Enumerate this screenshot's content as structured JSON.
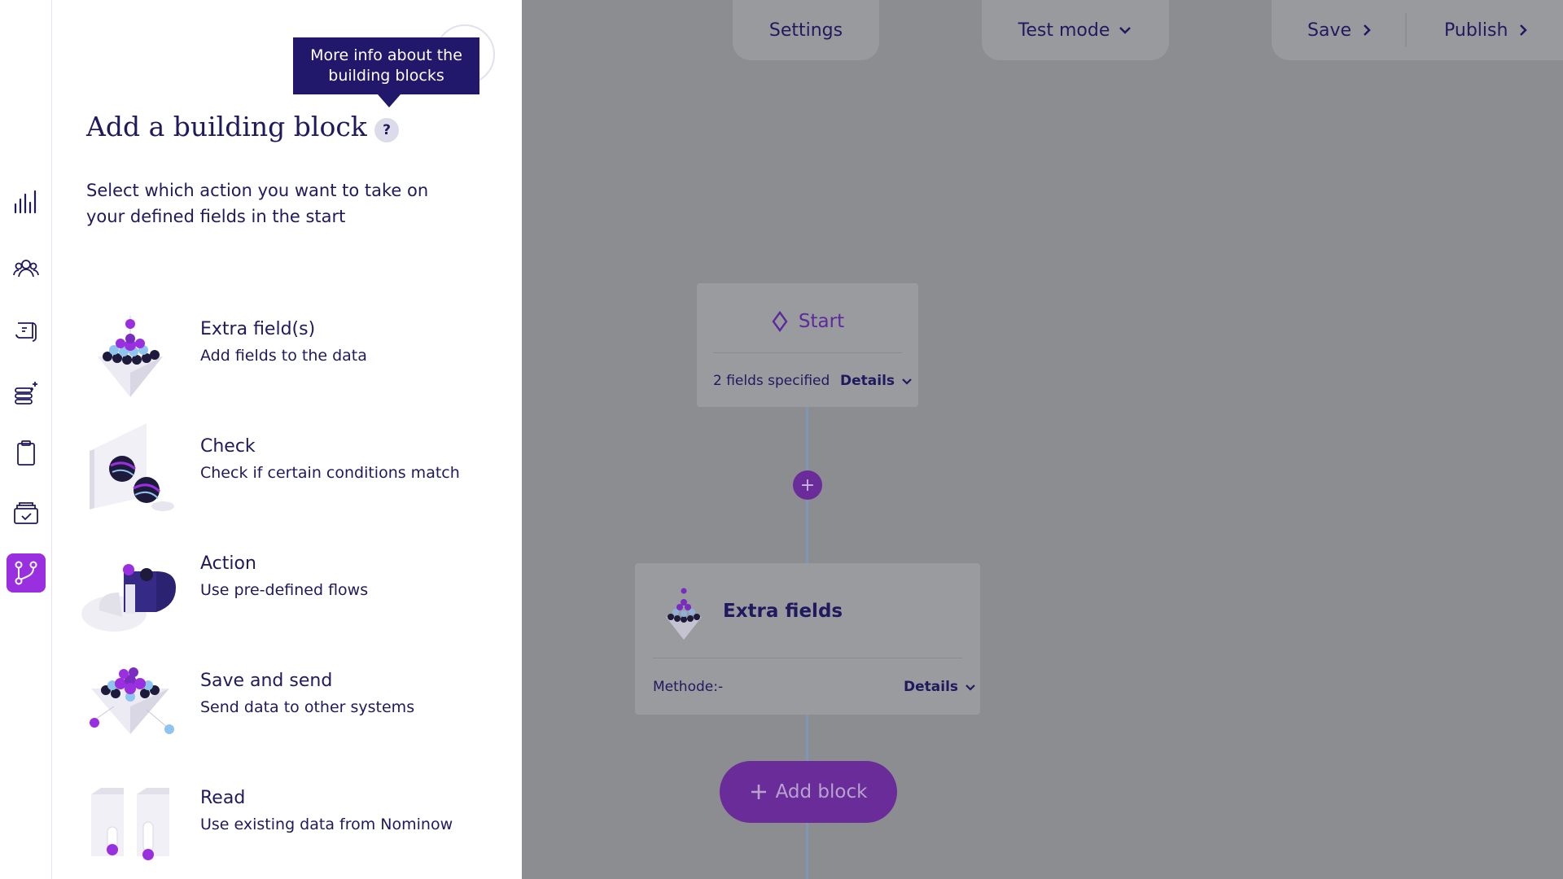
{
  "nav": {
    "items": [
      {
        "icon": "bar-chart-icon",
        "active": false
      },
      {
        "icon": "users-icon",
        "active": false
      },
      {
        "icon": "scroll-icon",
        "active": false
      },
      {
        "icon": "database-sparkle-icon",
        "active": false
      },
      {
        "icon": "clipboard-icon",
        "active": false
      },
      {
        "icon": "inbox-check-icon",
        "active": true
      },
      {
        "icon": "flow-branch-icon",
        "active": true
      }
    ],
    "active_color": "#9a2fe0"
  },
  "drawer": {
    "title": "Add a building block",
    "help_label": "?",
    "tooltip": "More info about the building blocks",
    "description": "Select which action you want to take on your defined fields in the start",
    "blocks": [
      {
        "title": "Extra field(s)",
        "subtitle": "Add fields to the data",
        "icon": "extra-fields-illustration"
      },
      {
        "title": "Check",
        "subtitle": "Check if certain conditions match",
        "icon": "check-illustration"
      },
      {
        "title": "Action",
        "subtitle": "Use pre-defined flows",
        "icon": "action-illustration"
      },
      {
        "title": "Save and send",
        "subtitle": "Send data to other systems",
        "icon": "save-send-illustration"
      },
      {
        "title": "Read",
        "subtitle": "Use existing data from Nominow",
        "icon": "read-illustration"
      }
    ]
  },
  "topbar": {
    "settings": "Settings",
    "test_mode": "Test mode",
    "save": "Save",
    "publish": "Publish"
  },
  "flow": {
    "start": {
      "title": "Start",
      "meta": "2 fields specified",
      "details": "Details"
    },
    "add_between": "+",
    "extra": {
      "title": "Extra fields",
      "meta": "Methode:-",
      "details": "Details"
    },
    "add_block": "Add block"
  },
  "colors": {
    "primary": "#1f1a5e",
    "accent": "#9a2fe0",
    "overlay": "#8c8d91"
  }
}
